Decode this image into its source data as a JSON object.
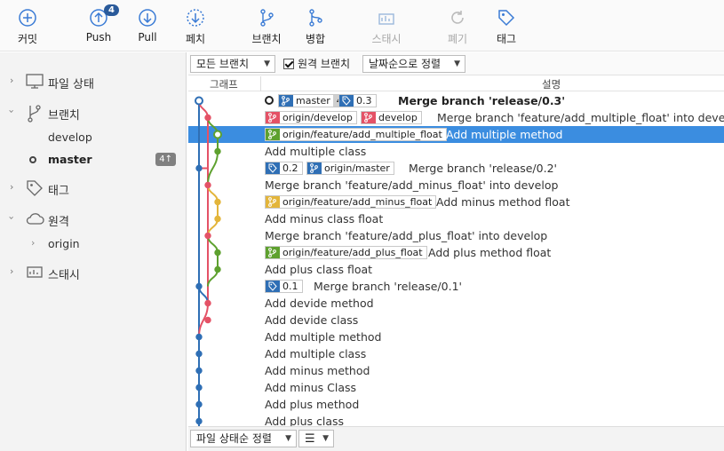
{
  "toolbar": {
    "commit": "커밋",
    "push": "Push",
    "push_badge": "4",
    "pull": "Pull",
    "fetch": "페치",
    "branch": "브랜치",
    "merge": "병합",
    "stash": "스태시",
    "discard": "폐기",
    "tag": "태그"
  },
  "sidebar": {
    "file_status": "파일 상태",
    "branches": "브랜치",
    "branch_items": [
      {
        "label": "develop"
      },
      {
        "label": "master",
        "badge": "4↑"
      }
    ],
    "tags": "태그",
    "remotes": "원격",
    "remote_items": [
      {
        "label": "origin"
      }
    ],
    "stashes": "스태시"
  },
  "filter": {
    "branches_dropdown": "모든 브랜치",
    "remote_checkbox": "원격 브랜치",
    "sort_dropdown": "날짜순으로 정렬"
  },
  "columns": {
    "graph": "그래프",
    "description": "설명"
  },
  "commits": [
    {
      "refs": [
        "master",
        "4",
        "0.3"
      ],
      "message": "Merge branch 'release/0.3'"
    },
    {
      "refs": [
        "origin/develop",
        "develop"
      ],
      "message": "Merge branch 'feature/add_multiple_float' into develop"
    },
    {
      "refs": [
        "origin/feature/add_multiple_float"
      ],
      "message": "Add multiple method"
    },
    {
      "refs": [],
      "message": "Add multiple class"
    },
    {
      "refs": [
        "0.2",
        "origin/master"
      ],
      "message": "Merge branch 'release/0.2'"
    },
    {
      "refs": [],
      "message": "Merge branch 'feature/add_minus_float' into develop"
    },
    {
      "refs": [
        "origin/feature/add_minus_float"
      ],
      "message": "Add minus method float"
    },
    {
      "refs": [],
      "message": "Add minus class float"
    },
    {
      "refs": [],
      "message": "Merge branch 'feature/add_plus_float' into develop"
    },
    {
      "refs": [
        "origin/feature/add_plus_float"
      ],
      "message": "Add plus method float"
    },
    {
      "refs": [],
      "message": "Add plus class float"
    },
    {
      "refs": [
        "0.1"
      ],
      "message": "Merge branch 'release/0.1'"
    },
    {
      "refs": [],
      "message": "Add devide method"
    },
    {
      "refs": [],
      "message": "Add devide class"
    },
    {
      "refs": [],
      "message": "Add multiple method"
    },
    {
      "refs": [],
      "message": "Add multiple class"
    },
    {
      "refs": [],
      "message": "Add minus method"
    },
    {
      "refs": [],
      "message": "Add minus Class"
    },
    {
      "refs": [],
      "message": "Add plus method"
    },
    {
      "refs": [],
      "message": "Add plus class"
    }
  ],
  "bottom": {
    "file_sort": "파일 상태순 정렬"
  },
  "colors": {
    "selection": "#3b8de0",
    "blue": "#2f6fb5",
    "red": "#e45266",
    "green": "#5ea12f",
    "yellow": "#e3b53a"
  }
}
